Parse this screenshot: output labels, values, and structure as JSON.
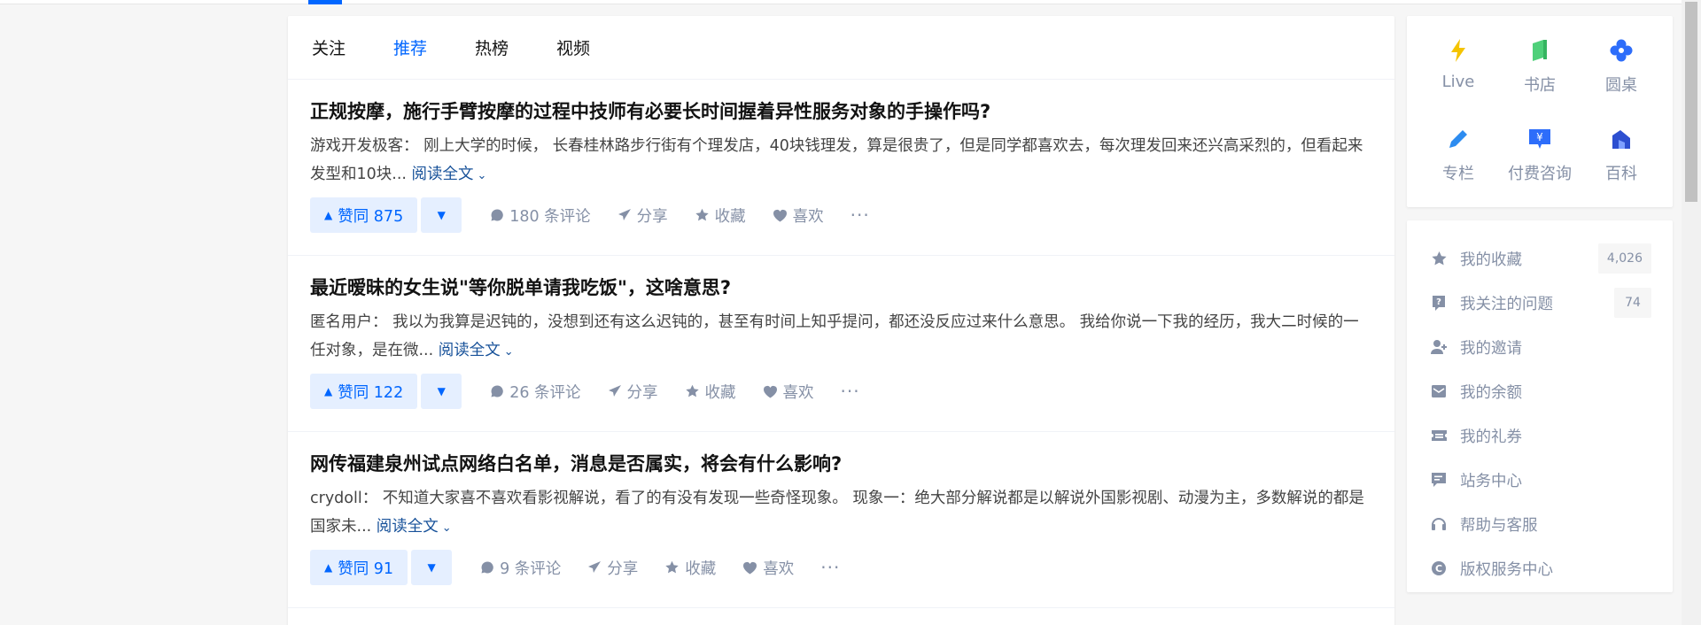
{
  "feed": {
    "tabs": [
      {
        "label": "关注"
      },
      {
        "label": "推荐"
      },
      {
        "label": "热榜"
      },
      {
        "label": "视频"
      }
    ],
    "items": [
      {
        "title": "正规按摩，施行手臂按摩的过程中技师有必要长时间握着异性服务对象的手操作吗?",
        "author": "游戏开发极客：",
        "excerpt": "刚上大学的时候， 长春桂林路步行街有个理发店，40块钱理发，算是很贵了，但是同学都喜欢去，每次理发回来还兴高采烈的，但看起来发型和10块...",
        "read_more": "阅读全文",
        "vote": "赞同 875",
        "comments": "180 条评论",
        "share": "分享",
        "favorite": "收藏",
        "like": "喜欢"
      },
      {
        "title": "最近暧昧的女生说\"等你脱单请我吃饭\"，这啥意思?",
        "author": "匿名用户：",
        "excerpt": "我以为我算是迟钝的，没想到还有这么迟钝的，甚至有时间上知乎提问，都还没反应过来什么意思。 我给你说一下我的经历，我大二时候的一任对象，是在微...",
        "read_more": "阅读全文",
        "vote": "赞同 122",
        "comments": "26 条评论",
        "share": "分享",
        "favorite": "收藏",
        "like": "喜欢"
      },
      {
        "title": "网传福建泉州试点网络白名单，消息是否属实，将会有什么影响?",
        "author": "crydoll：",
        "excerpt": "不知道大家喜不喜欢看影视解说，看了的有没有发现一些奇怪现象。 现象一：绝大部分解说都是以解说外国影视剧、动漫为主，多数解说的都是国家未...",
        "read_more": "阅读全文",
        "vote": "赞同 91",
        "comments": "9 条评论",
        "share": "分享",
        "favorite": "收藏",
        "like": "喜欢"
      }
    ]
  },
  "sidebar": {
    "grid": [
      {
        "label": "Live",
        "icon": "lightning-icon",
        "color": "#f5c400"
      },
      {
        "label": "书店",
        "icon": "book-icon",
        "color": "#4fd07a"
      },
      {
        "label": "圆桌",
        "icon": "roundtable-icon",
        "color": "#2d6dfa"
      },
      {
        "label": "专栏",
        "icon": "pen-icon",
        "color": "#2d8cf0"
      },
      {
        "label": "付费咨询",
        "icon": "paid-consult-icon",
        "color": "#2d6dfa"
      },
      {
        "label": "百科",
        "icon": "encyclopedia-icon",
        "color": "#2d4fd0"
      }
    ],
    "menu": [
      {
        "label": "我的收藏",
        "count": "4,026",
        "icon": "star-icon"
      },
      {
        "label": "我关注的问题",
        "count": "74",
        "icon": "question-icon"
      },
      {
        "label": "我的邀请",
        "icon": "invite-icon"
      },
      {
        "label": "我的余额",
        "icon": "balance-icon"
      },
      {
        "label": "我的礼券",
        "icon": "coupon-icon"
      },
      {
        "label": "站务中心",
        "icon": "station-icon"
      },
      {
        "label": "帮助与客服",
        "icon": "headset-icon"
      },
      {
        "label": "版权服务中心",
        "icon": "copyright-icon"
      }
    ]
  },
  "colors": {
    "accent": "#0066ff",
    "muted": "#8590a6",
    "link": "#175199"
  }
}
